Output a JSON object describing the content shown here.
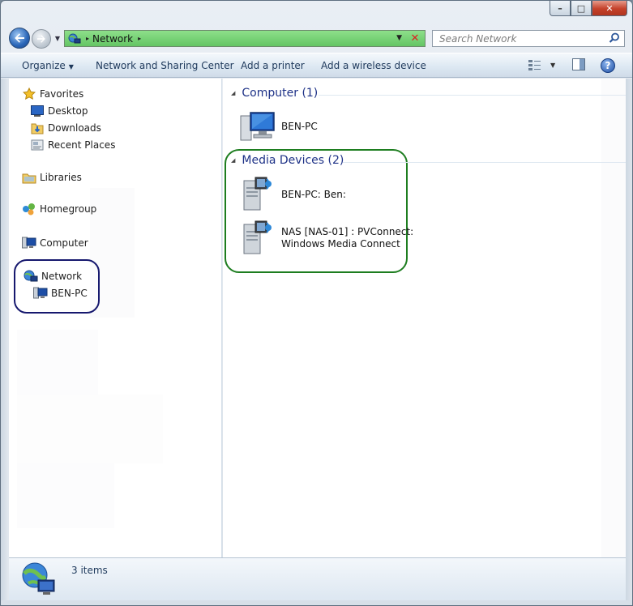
{
  "window": {
    "caption_minimize": "–",
    "caption_maximize": "□",
    "caption_close": "✕"
  },
  "address": {
    "segment": "Network",
    "arrow": "▸"
  },
  "search": {
    "placeholder": "Search Network"
  },
  "toolbar": {
    "organize": "Organize",
    "network_sharing": "Network and Sharing Center",
    "add_printer": "Add a printer",
    "add_wireless": "Add a wireless device",
    "help": "?"
  },
  "sidebar": {
    "favorites": "Favorites",
    "desktop": "Desktop",
    "downloads": "Downloads",
    "recent": "Recent Places",
    "libraries": "Libraries",
    "homegroup": "Homegroup",
    "computer": "Computer",
    "network": "Network",
    "network_child": "BEN-PC"
  },
  "groups": {
    "computer": {
      "title": "Computer (1)",
      "items": [
        "BEN-PC"
      ]
    },
    "media": {
      "title": "Media Devices (2)",
      "items": [
        {
          "line1": "BEN-PC: Ben:",
          "line2": ""
        },
        {
          "line1": "NAS [NAS-01] : PVConnect:",
          "line2": "Windows Media Connect"
        }
      ]
    }
  },
  "details": {
    "count": "3 items"
  },
  "colors": {
    "address_bar": "#78d278",
    "media_highlight": "#1d7d1f",
    "network_highlight": "#16186e",
    "group_title": "#1e3287"
  }
}
